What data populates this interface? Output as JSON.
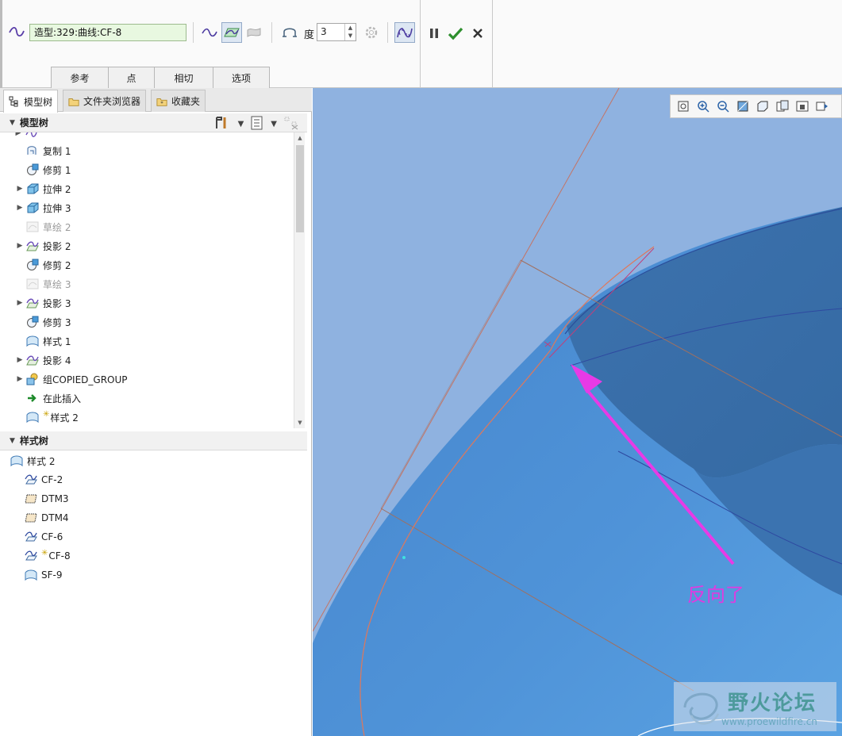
{
  "ribbon": {
    "feature_name": "造型:329:曲线:CF-8",
    "degree_label": "度",
    "degree_value": "3",
    "tabs": [
      "参考",
      "点",
      "相切",
      "选项"
    ],
    "actions": {
      "pause": "pause-icon",
      "ok": "checkmark-icon",
      "cancel": "x-icon"
    }
  },
  "panel": {
    "tabs": [
      "模型树",
      "文件夹浏览器",
      "收藏夹"
    ],
    "model_tree_header": "模型树",
    "style_tree_header": "样式树",
    "model_tree": [
      {
        "label": "复制 1",
        "icon": "copy-icon",
        "expandable": false,
        "dim": false
      },
      {
        "label": "修剪 1",
        "icon": "trim-icon",
        "expandable": false,
        "dim": false
      },
      {
        "label": "拉伸 2",
        "icon": "extrude-icon",
        "expandable": true,
        "dim": false
      },
      {
        "label": "拉伸 3",
        "icon": "extrude-icon",
        "expandable": true,
        "dim": false
      },
      {
        "label": "草绘 2",
        "icon": "sketch-icon",
        "expandable": false,
        "dim": true
      },
      {
        "label": "投影 2",
        "icon": "projection-icon",
        "expandable": true,
        "dim": false
      },
      {
        "label": "修剪 2",
        "icon": "trim-icon",
        "expandable": false,
        "dim": false
      },
      {
        "label": "草绘 3",
        "icon": "sketch-icon",
        "expandable": false,
        "dim": true
      },
      {
        "label": "投影 3",
        "icon": "projection-icon",
        "expandable": true,
        "dim": false
      },
      {
        "label": "修剪 3",
        "icon": "trim-icon",
        "expandable": false,
        "dim": false
      },
      {
        "label": "样式 1",
        "icon": "style-icon",
        "expandable": false,
        "dim": false
      },
      {
        "label": "投影 4",
        "icon": "projection-icon",
        "expandable": true,
        "dim": false
      },
      {
        "label": "组COPIED_GROUP",
        "icon": "group-icon",
        "expandable": true,
        "dim": false
      },
      {
        "label": "在此插入",
        "icon": "insert-here-icon",
        "expandable": false,
        "dim": false
      },
      {
        "label": "样式 2",
        "icon": "style-icon",
        "expandable": false,
        "dim": false,
        "new": true
      }
    ],
    "style_tree_root": "样式 2",
    "style_tree": [
      {
        "label": "CF-2",
        "icon": "curve-icon",
        "new": false
      },
      {
        "label": "DTM3",
        "icon": "datum-plane-icon",
        "new": false
      },
      {
        "label": "DTM4",
        "icon": "datum-plane-icon",
        "new": false
      },
      {
        "label": "CF-6",
        "icon": "curve-icon",
        "new": false
      },
      {
        "label": "CF-8",
        "icon": "curve-icon",
        "new": true
      },
      {
        "label": "SF-9",
        "icon": "surface-icon",
        "new": false
      }
    ]
  },
  "viewport": {
    "annotation": "反向了",
    "watermark_title": "野火论坛",
    "watermark_url": "www.proewildfire.cn",
    "colors": {
      "background": "#8fb2e0",
      "surface": "#4f8fd4",
      "surface_dark": "#3a70ac",
      "curve": "#e0785a",
      "arrow": "#e83ae6"
    }
  }
}
